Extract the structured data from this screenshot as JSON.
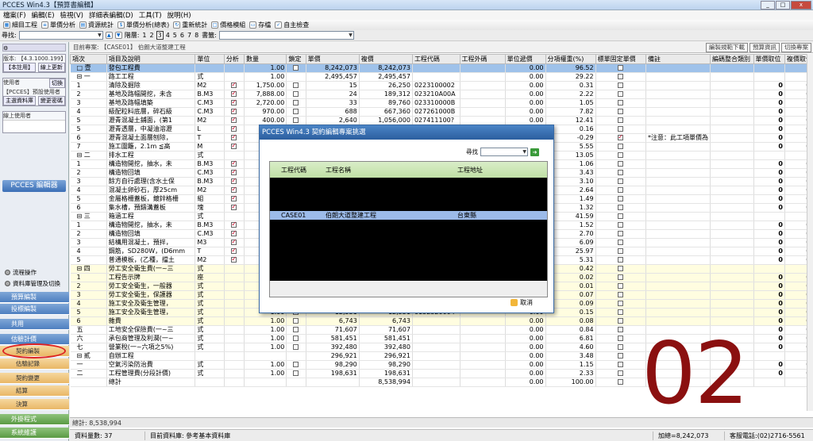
{
  "window_title": "PCCES Win4.3【預算書編輯】",
  "window_buttons": [
    "_",
    "□",
    "x"
  ],
  "menu": [
    "檔案(F)",
    "編輯(E)",
    "檢視(V)",
    "詳細表編輯(D)",
    "工具(T)",
    "說明(H)"
  ],
  "toolbar": [
    {
      "icon": "grid-icon",
      "label": "細目工程"
    },
    {
      "icon": "list-icon",
      "label": "單價分析"
    },
    {
      "icon": "table-icon",
      "label": "資源統計"
    },
    {
      "icon": "coin-icon",
      "label": "單價分析(總表)"
    },
    {
      "icon": "refresh-icon",
      "label": "重新統計"
    },
    {
      "icon": "box-icon",
      "label": "價格模組"
    },
    {
      "icon": "doc-icon",
      "label": "存檔"
    },
    {
      "icon": "check-icon",
      "label": "自主檢查"
    }
  ],
  "searchbar": {
    "find_label": "尋找:",
    "level_label": "階層:",
    "levels": [
      "1",
      "2",
      "3",
      "4",
      "5",
      "6",
      "7",
      "8"
    ],
    "selected_level": "3",
    "bookmark_label": "書籤:"
  },
  "left": {
    "version": "版本: 【4.3.1000.199】",
    "btn1": "【本註用】",
    "btn2": "線上更新",
    "user_label": "使用者",
    "user_btn": "切換",
    "user_name": "【PCCES】預設使用者",
    "btn3": "主選資料庫",
    "btn4": "變更密碼",
    "online_label": "線上使用者",
    "logo": "PCCES 編輯器",
    "radios": [
      "流程操作",
      "資料庫管理及切換"
    ],
    "nav": [
      {
        "label": "預算編製",
        "type": "blue"
      },
      {
        "label": "投標編製",
        "type": "blue"
      },
      {
        "label": "共用",
        "type": "blue"
      },
      {
        "label": "估驗計價",
        "type": "blue"
      },
      {
        "label": "契約編製",
        "type": "sub"
      },
      {
        "label": "估驗記錄",
        "type": "sub"
      },
      {
        "label": "契約變更",
        "type": "sub"
      },
      {
        "label": "結算",
        "type": "sub"
      },
      {
        "label": "決算",
        "type": "sub"
      },
      {
        "label": "外掛程式",
        "type": "green"
      },
      {
        "label": "系統維護",
        "type": "green"
      }
    ]
  },
  "project_bar": "目前專案: 【CASE01】 伯朗大道整建工程",
  "right_buttons": [
    "編製規範下載",
    "預算資訊",
    "切換專案"
  ],
  "columns": [
    "項次",
    "項目及說明",
    "單位",
    "分析",
    "數量",
    "鎖定",
    "單價",
    "複價",
    "工程代碼",
    "工程外碼",
    "單位遞價",
    "分項權重(%)",
    "標單固定單價",
    "備註",
    "編碼整合類別",
    "單價取位",
    "複價取位"
  ],
  "rows": [
    {
      "c": [
        "□ 壹",
        "發包工程費",
        "",
        "",
        "1.00",
        "□",
        "8,242,073",
        "8,242,073",
        "",
        "",
        "0.00",
        "96.52",
        "□",
        "",
        "",
        "",
        ""
      ],
      "sel": true
    },
    {
      "c": [
        "⊟ 一",
        "路工工程",
        "式",
        "",
        "1.00",
        "",
        "2,495,457",
        "2,495,457",
        "",
        "",
        "0.00",
        "29.22",
        "□",
        "",
        "",
        "",
        ""
      ]
    },
    {
      "c": [
        "1",
        "清除及掘除",
        "M2",
        "✓",
        "1,750.00",
        "□",
        "15",
        "26,250",
        "0223100002",
        "",
        "0.00",
        "0.31",
        "□",
        "",
        "",
        "0",
        "0"
      ]
    },
    {
      "c": [
        "2",
        "基地及路幅開挖，未含",
        "B.M3",
        "✓",
        "7,888.00",
        "□",
        "24",
        "189,312",
        "023210A00A",
        "",
        "0.00",
        "2.22",
        "□",
        "",
        "",
        "0",
        "0"
      ]
    },
    {
      "c": [
        "3",
        "基地及路幅填築",
        "C.M3",
        "✓",
        "2,720.00",
        "□",
        "33",
        "89,760",
        "023310000B",
        "",
        "0.00",
        "1.05",
        "□",
        "",
        "",
        "0",
        "0"
      ]
    },
    {
      "c": [
        "4",
        "級配粒料底層，碎石級",
        "C.M3",
        "✓",
        "970.00",
        "□",
        "688",
        "667,360",
        "027261000B",
        "",
        "0.00",
        "7.82",
        "□",
        "",
        "",
        "0",
        "0"
      ]
    },
    {
      "c": [
        "5",
        "瀝青混凝土鋪面，(第1",
        "M2",
        "✓",
        "400.00",
        "□",
        "2,640",
        "1,056,000",
        "027411100?",
        "",
        "0.00",
        "12.41",
        "□",
        "",
        "",
        "0",
        "0"
      ]
    },
    {
      "c": [
        "5",
        "瀝青透層，中凝油溶瀝",
        "L",
        "✓",
        "75",
        "",
        "",
        "",
        "",
        "",
        "0.00",
        "0.16",
        "□",
        "",
        "",
        "0",
        "0"
      ]
    },
    {
      "c": [
        "6",
        "瀝青混凝土面層刨除，",
        "T",
        "✓",
        "",
        "",
        "",
        "",
        "",
        "",
        "0.00",
        "-0.29",
        "✓",
        "*注意：此工項單價為",
        "",
        "0",
        "0"
      ]
    },
    {
      "c": [
        "7",
        "施工圍籬，2.1m ≦高",
        "M",
        "✓",
        "",
        "",
        "",
        "",
        "",
        "",
        "0.00",
        "5.55",
        "□",
        "",
        "",
        "0",
        "0"
      ]
    },
    {
      "c": [
        "⊟ 二",
        "排水工程",
        "式",
        "",
        "",
        "",
        "",
        "",
        "",
        "",
        "0.00",
        "13.05",
        "□",
        "",
        "",
        "",
        ""
      ]
    },
    {
      "c": [
        "1",
        "構造物開挖，抽水，未",
        "B.M3",
        "✓",
        "2,5",
        "",
        "",
        "",
        "",
        "",
        "0.00",
        "1.06",
        "□",
        "",
        "",
        "0",
        "0"
      ]
    },
    {
      "c": [
        "2",
        "構造物回填",
        "C.M3",
        "✓",
        "1,7",
        "",
        "",
        "",
        "",
        "",
        "0.00",
        "3.43",
        "□",
        "",
        "",
        "0",
        "0"
      ]
    },
    {
      "c": [
        "3",
        "餘方自行處理(含水土保",
        "B.M3",
        "✓",
        "2,1",
        "",
        "",
        "",
        "",
        "",
        "0.00",
        "3.10",
        "□",
        "",
        "",
        "0",
        "0"
      ]
    },
    {
      "c": [
        "4",
        "混凝土卵砂石，厚25cm",
        "M2",
        "✓",
        "",
        "",
        "",
        "",
        "",
        "",
        "0.00",
        "2.64",
        "□",
        "",
        "",
        "0",
        "0"
      ]
    },
    {
      "c": [
        "5",
        "金屬格柵蓋板，鍍鋅格柵",
        "組",
        "✓",
        "",
        "",
        "",
        "",
        "",
        "",
        "0.00",
        "1.49",
        "□",
        "",
        "",
        "0",
        "0"
      ]
    },
    {
      "c": [
        "6",
        "集水槽，預鑄溝蓋板",
        "塊",
        "✓",
        "1",
        "",
        "",
        "",
        "",
        "",
        "0.00",
        "1.32",
        "□",
        "",
        "",
        "0",
        "0"
      ]
    },
    {
      "c": [
        "⊟ 三",
        "箱涵工程",
        "式",
        "",
        "",
        "",
        "",
        "",
        "",
        "",
        "0.00",
        "41.59",
        "□",
        "",
        "",
        "",
        ""
      ]
    },
    {
      "c": [
        "1",
        "構造物開挖，抽水，未",
        "B.M3",
        "✓",
        "3,6",
        "",
        "",
        "",
        "",
        "",
        "0.00",
        "1.52",
        "□",
        "",
        "",
        "0",
        "0"
      ]
    },
    {
      "c": [
        "2",
        "構造物回填",
        "C.M3",
        "✓",
        "1,3",
        "",
        "",
        "",
        "",
        "",
        "0.00",
        "2.70",
        "□",
        "",
        "",
        "0",
        "0"
      ]
    },
    {
      "c": [
        "3",
        "結構用混凝土，預拌，",
        "M3",
        "✓",
        "",
        "",
        "",
        "",
        "",
        "",
        "0.00",
        "6.09",
        "□",
        "",
        "",
        "0",
        "0"
      ]
    },
    {
      "c": [
        "4",
        "鋼筋，SD280W，(D6mm",
        "T",
        "✓",
        "1",
        "",
        "",
        "",
        "",
        "",
        "0.00",
        "25.97",
        "□",
        "",
        "",
        "0",
        "0"
      ]
    },
    {
      "c": [
        "5",
        "普通模板，(乙種，擋土",
        "M2",
        "✓",
        "1,1",
        "",
        "",
        "",
        "",
        "",
        "0.00",
        "5.31",
        "□",
        "",
        "",
        "0",
        "0"
      ]
    },
    {
      "c": [
        "⊟ 四",
        "勞工安全衛生費(一~三",
        "式",
        "",
        "",
        "",
        "",
        "",
        "",
        "",
        "0.00",
        "0.42",
        "□",
        "",
        "",
        "",
        ""
      ],
      "yel": true
    },
    {
      "c": [
        "1",
        "工程告示牌",
        "座",
        "",
        "",
        "",
        "",
        "",
        "",
        "",
        "0.00",
        "0.02",
        "□",
        "",
        "",
        "0",
        "0"
      ],
      "yel": true
    },
    {
      "c": [
        "2",
        "勞工安全衛生，一般器",
        "式",
        "",
        "",
        "",
        "",
        "",
        "",
        "",
        "0.00",
        "0.01",
        "□",
        "",
        "",
        "0",
        "0"
      ],
      "yel": true
    },
    {
      "c": [
        "3",
        "勞工安全衛生，保護器",
        "式",
        "",
        "",
        "",
        "",
        "",
        "",
        "",
        "0.00",
        "0.07",
        "□",
        "",
        "",
        "0",
        "0"
      ],
      "yel": true
    },
    {
      "c": [
        "4",
        "施工安全及衛生管理，",
        "式",
        "",
        "1.00",
        "□",
        "7,396",
        "7,396",
        "0152310004",
        "",
        "0.00",
        "0.09",
        "□",
        "",
        "",
        "0",
        "0"
      ],
      "yel": true
    },
    {
      "c": [
        "5",
        "施工安全及衛生管理，",
        "式",
        "",
        "1.00",
        "□",
        "12,551",
        "12,551",
        "0152320004",
        "",
        "0.00",
        "0.15",
        "□",
        "",
        "",
        "0",
        "0"
      ],
      "yel": true
    },
    {
      "c": [
        "6",
        "雜費",
        "式",
        "",
        "1.00",
        "□",
        "6,743",
        "6,743",
        "",
        "",
        "0.00",
        "0.08",
        "□",
        "",
        "",
        "0",
        "0"
      ],
      "yel": true
    },
    {
      "c": [
        "五",
        "工地安全保險費(一~三",
        "式",
        "",
        "1.00",
        "□",
        "71,607",
        "71,607",
        "",
        "",
        "0.00",
        "0.84",
        "□",
        "",
        "",
        "0",
        "0"
      ]
    },
    {
      "c": [
        "六",
        "承包商管理及利潤(一~",
        "式",
        "",
        "1.00",
        "□",
        "581,451",
        "581,451",
        "",
        "",
        "0.00",
        "6.81",
        "□",
        "",
        "",
        "0",
        "0"
      ]
    },
    {
      "c": [
        "七",
        "營業稅(一~六項之5%)",
        "式",
        "",
        "1.00",
        "□",
        "392,480",
        "392,480",
        "",
        "",
        "0.00",
        "4.60",
        "□",
        "",
        "",
        "0",
        "0"
      ]
    },
    {
      "c": [
        "⊟ 貳",
        "自辦工程",
        "",
        "",
        "",
        "",
        "296,921",
        "296,921",
        "",
        "",
        "0.00",
        "3.48",
        "□",
        "",
        "",
        "",
        ""
      ]
    },
    {
      "c": [
        "一",
        "空氣污染防治費",
        "式",
        "",
        "1.00",
        "□",
        "98,290",
        "98,290",
        "",
        "",
        "0.00",
        "1.15",
        "□",
        "",
        "",
        "0",
        "0"
      ]
    },
    {
      "c": [
        "二",
        "工程管理費(分段計價)",
        "式",
        "",
        "1.00",
        "□",
        "198,631",
        "198,631",
        "",
        "",
        "0.00",
        "2.33",
        "□",
        "",
        "",
        "0",
        "0"
      ]
    },
    {
      "c": [
        "",
        "總計",
        "",
        "",
        "",
        "",
        "",
        "8,538,994",
        "",
        "",
        "0.00",
        "100.00",
        "□",
        "",
        "",
        "",
        ""
      ]
    }
  ],
  "total_bar": "總計: 8,538,994",
  "status": [
    "資料量數: 37",
    "目前資料庫: 參考基本資料庫",
    "加總=8,242,073",
    "客服電話:(02)2716-5561"
  ],
  "dialog": {
    "title": "PCCES Win4.3  契約編輯專案挑選",
    "search_label": "尋找",
    "headers": [
      "工程代碼",
      "工程名稱",
      "工程地址"
    ],
    "row": {
      "code": "CASE01",
      "name": "伯朗大道整建工程",
      "addr": "台東縣"
    },
    "cancel": "取消"
  },
  "overlay_number": "02",
  "colors": {
    "selected_row": "#9fc2ea",
    "dialog_title": "#2c5f9f",
    "overlay": "#8b1010",
    "circle": "#dd2222"
  }
}
